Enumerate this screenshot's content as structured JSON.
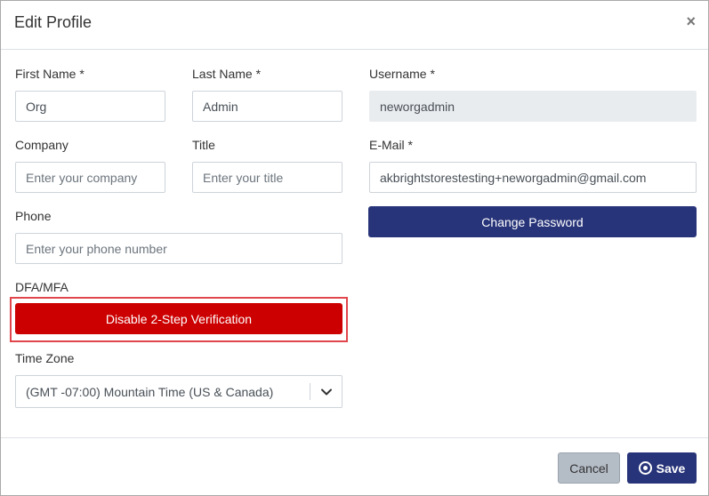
{
  "dialog": {
    "title": "Edit Profile",
    "close_icon": "close-icon"
  },
  "form": {
    "first_name": {
      "label": "First Name *",
      "value": "Org"
    },
    "last_name": {
      "label": "Last Name *",
      "value": "Admin"
    },
    "username": {
      "label": "Username *",
      "value": "neworgadmin"
    },
    "company": {
      "label": "Company",
      "placeholder": "Enter your company"
    },
    "title": {
      "label": "Title",
      "placeholder": "Enter your title"
    },
    "email": {
      "label": "E-Mail *",
      "value": "akbrightstorestesting+neworgadmin@gmail.com"
    },
    "phone": {
      "label": "Phone",
      "placeholder": "Enter your phone number"
    },
    "change_password_label": "Change Password",
    "mfa": {
      "label": "DFA/MFA",
      "button_label": "Disable 2-Step Verification"
    },
    "time_zone": {
      "label": "Time Zone",
      "selected": "(GMT -07:00) Mountain Time (US & Canada)"
    }
  },
  "footer": {
    "cancel_label": "Cancel",
    "save_label": "Save",
    "save_icon": "record-circle-icon"
  },
  "colors": {
    "primary": "#283479",
    "danger": "#cc0000",
    "highlight": "#e0464c",
    "cancel_bg": "#b4bcc6"
  }
}
